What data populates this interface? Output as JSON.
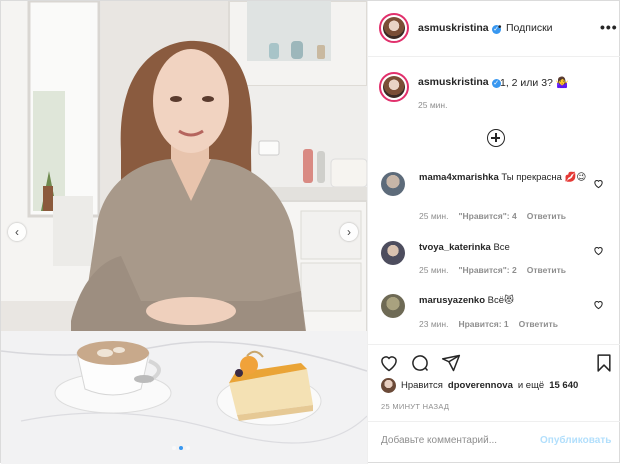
{
  "post": {
    "dots": [
      false,
      true,
      false
    ]
  },
  "header": {
    "username": "asmuskristina",
    "separator": "•",
    "follow_label": "Подписки",
    "more_label": "•••"
  },
  "caption": {
    "username": "asmuskristina",
    "text": "1, 2 или 3? 🤷‍♀️",
    "time": "25 мин."
  },
  "comments": [
    {
      "username": "mama4xmarishka",
      "text": "Ты прекрасна 💋😉",
      "time": "25 мин.",
      "likes": "\"Нравится\": 4",
      "reply": "Ответить"
    },
    {
      "username": "tvoya_katerinka",
      "text": "Все",
      "time": "25 мин.",
      "likes": "\"Нравится\": 2",
      "reply": "Ответить"
    },
    {
      "username": "marusyazenko",
      "text": "Всё😻",
      "time": "23 мин.",
      "likes": "Нравится: 1",
      "reply": "Ответить"
    }
  ],
  "likes": {
    "prefix": "Нравится",
    "user": "dpoverennova",
    "mid": "и ещё",
    "count": "15 640"
  },
  "post_time": "25 МИНУТ НАЗАД",
  "add_comment": {
    "placeholder": "Добавьте комментарий...",
    "publish_label": "Опубликовать"
  },
  "colors": {
    "accent": "#3897f0",
    "publish_disabled": "#b2dffc",
    "story_ring": "#e1306c"
  }
}
